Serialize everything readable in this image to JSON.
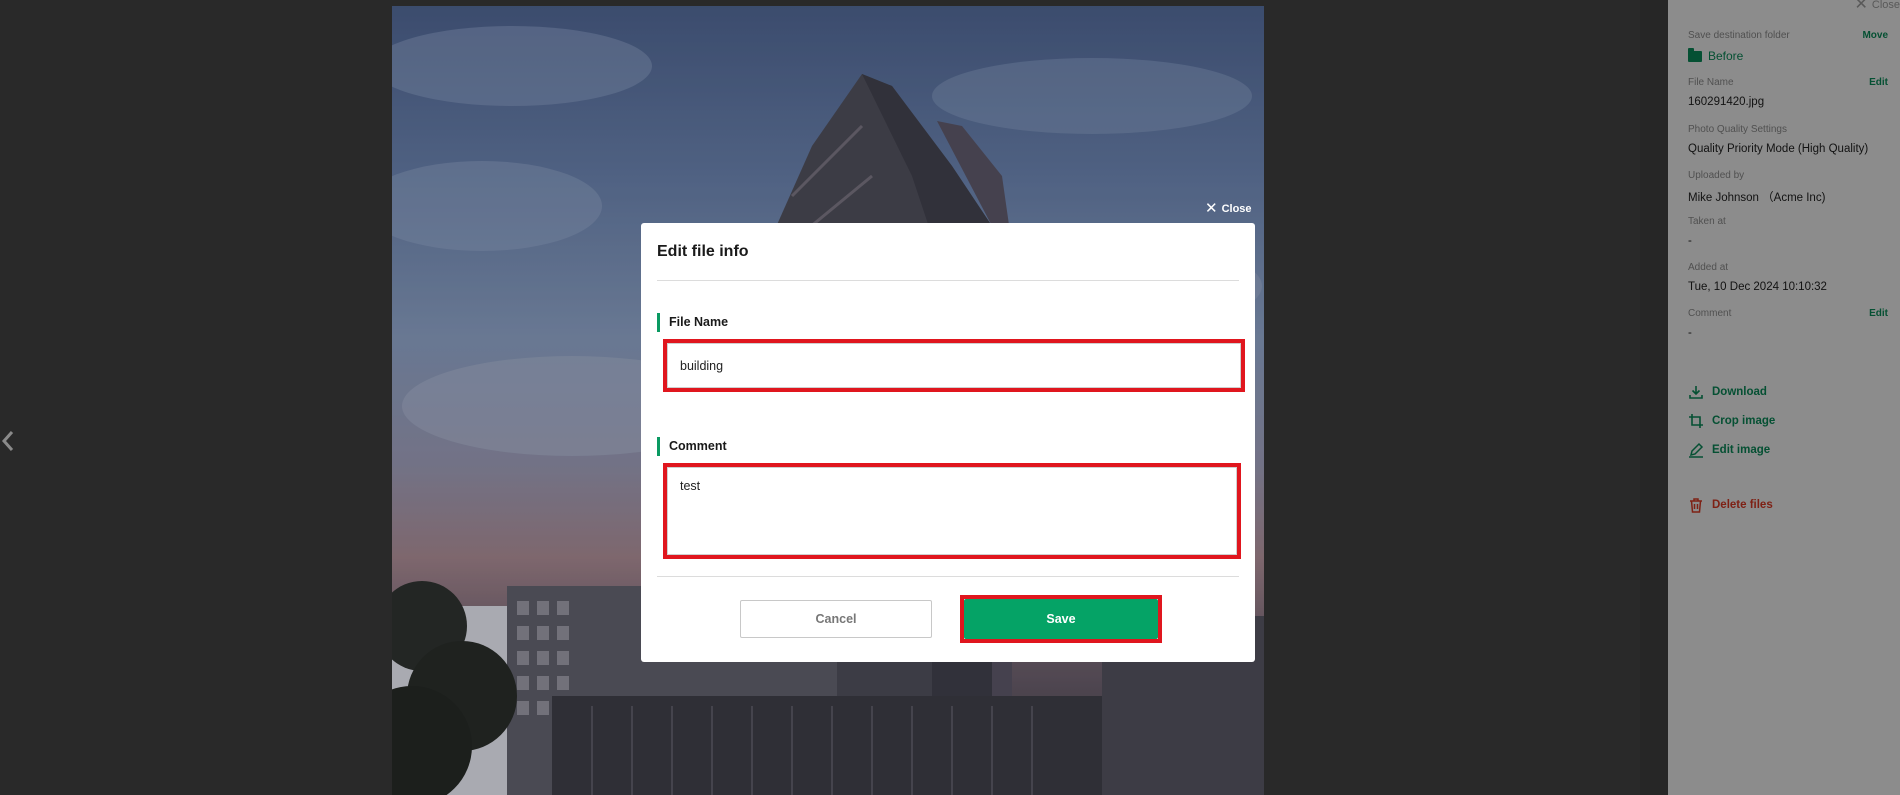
{
  "viewer": {
    "prev_icon": "chevron-left-icon"
  },
  "info_panel": {
    "close_label": "Close",
    "destination": {
      "label": "Save destination folder",
      "action": "Move",
      "folder": "Before",
      "icon": "folder-icon"
    },
    "file_name": {
      "label": "File Name",
      "action": "Edit",
      "value": "160291420.jpg"
    },
    "quality": {
      "label": "Photo Quality Settings",
      "value": "Quality Priority Mode (High Quality)"
    },
    "uploaded_by": {
      "label": "Uploaded by",
      "value": "Mike Johnson （Acme Inc)"
    },
    "taken_at": {
      "label": "Taken at",
      "value": "-"
    },
    "added_at": {
      "label": "Added at",
      "value": "Tue, 10 Dec 2024 10:10:32"
    },
    "comment": {
      "label": "Comment",
      "action": "Edit",
      "value": "-"
    },
    "actions": [
      {
        "label": "Download",
        "icon": "download-icon"
      },
      {
        "label": "Crop image",
        "icon": "crop-icon"
      },
      {
        "label": "Edit image",
        "icon": "pencil-icon"
      }
    ],
    "delete": {
      "label": "Delete files",
      "icon": "trash-icon"
    }
  },
  "modal": {
    "close_label": "Close",
    "title": "Edit file info",
    "file_name_label": "File Name",
    "file_name_value": "building",
    "comment_label": "Comment",
    "comment_value": "test",
    "cancel_label": "Cancel",
    "save_label": "Save"
  },
  "colors": {
    "accent": "#05a366",
    "highlight": "#e0161e",
    "danger": "#d93a25"
  }
}
